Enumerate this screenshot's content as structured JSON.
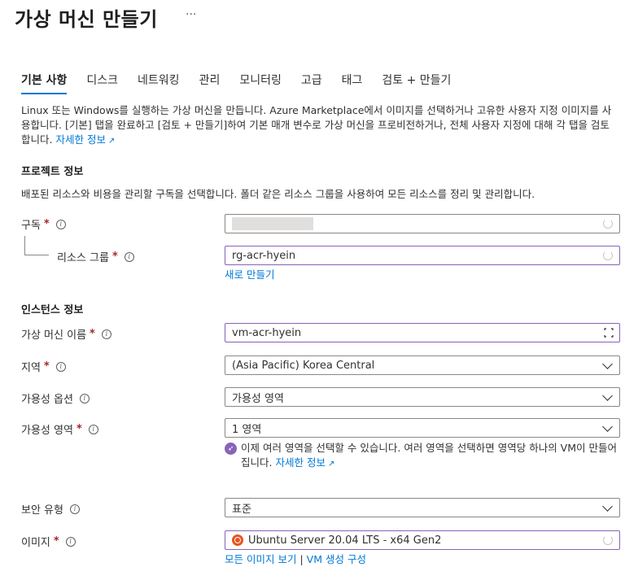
{
  "page": {
    "title": "가상 머신 만들기",
    "more": "···"
  },
  "tabs": [
    {
      "label": "기본 사항",
      "active": true
    },
    {
      "label": "디스크"
    },
    {
      "label": "네트워킹"
    },
    {
      "label": "관리"
    },
    {
      "label": "모니터링"
    },
    {
      "label": "고급"
    },
    {
      "label": "태그"
    },
    {
      "label": "검토 + 만들기"
    }
  ],
  "intro": {
    "text": "Linux 또는 Windows를 실행하는 가상 머신을 만듭니다. Azure Marketplace에서 이미지를 선택하거나 고유한 사용자 지정 이미지를 사용합니다. [기본] 탭을 완료하고 [검토 + 만들기]하여 기본 매개 변수로 가상 머신을 프로비전하거나, 전체 사용자 지정에 대해 각 탭을 검토합니다.",
    "link": "자세한 정보"
  },
  "project": {
    "title": "프로젝트 정보",
    "desc": "배포된 리소스와 비용을 관리할 구독을 선택합니다. 폴더 같은 리소스 그룹을 사용하여 모든 리소스를 정리 및 관리합니다.",
    "subscription_label": "구독",
    "subscription_value": "",
    "rg_label": "리소스 그룹",
    "rg_value": "rg-acr-hyein",
    "create_new": "새로 만들기"
  },
  "instance": {
    "title": "인스턴스 정보",
    "vm_name_label": "가상 머신 이름",
    "vm_name_value": "vm-acr-hyein",
    "region_label": "지역",
    "region_value": "(Asia Pacific) Korea Central",
    "avail_option_label": "가용성 옵션",
    "avail_option_value": "가용성 영역",
    "avail_zone_label": "가용성 영역",
    "avail_zone_value": "1 영역",
    "notice_text": "이제 여러 영역을 선택할 수 있습니다. 여러 영역을 선택하면 영역당 하나의 VM이 만들어집니다.",
    "notice_link": "자세한 정보",
    "security_label": "보안 유형",
    "security_value": "표준",
    "image_label": "이미지",
    "image_value": "Ubuntu Server 20.04 LTS - x64 Gen2",
    "all_images": "모든 이미지 보기",
    "vm_config": "VM 생성 구성"
  },
  "required_mark": "*",
  "info_glyph": "i"
}
